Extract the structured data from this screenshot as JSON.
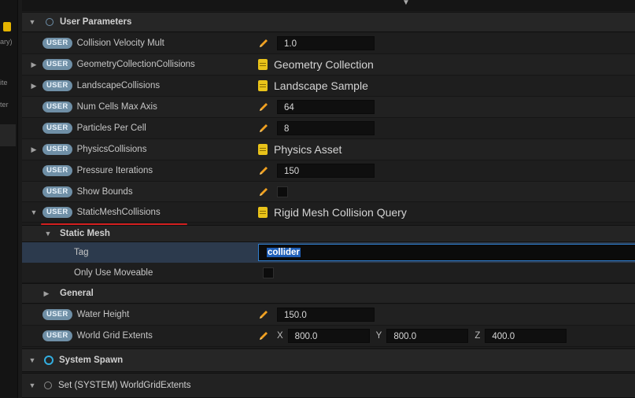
{
  "left_panel": {
    "frag1": "ary)",
    "frag2": "ite",
    "frag3": "ter"
  },
  "section_user": {
    "title": "User Parameters",
    "badge": "USER"
  },
  "params": [
    {
      "name": "Collision Velocity Mult",
      "value": "1.0"
    },
    {
      "name": "GeometryCollectionCollisions",
      "asset": "Geometry Collection"
    },
    {
      "name": "LandscapeCollisions",
      "asset": "Landscape Sample"
    },
    {
      "name": "Num Cells Max Axis",
      "value": "64"
    },
    {
      "name": "Particles Per Cell",
      "value": "8"
    },
    {
      "name": "PhysicsCollisions",
      "asset": "Physics Asset"
    },
    {
      "name": "Pressure Iterations",
      "value": "150"
    },
    {
      "name": "Show Bounds",
      "checked": false
    },
    {
      "name": "StaticMeshCollisions",
      "asset": "Rigid Mesh Collision Query"
    }
  ],
  "static_mesh": {
    "title": "Static Mesh",
    "tag_label": "Tag",
    "tag_value": "collider",
    "only_moveable_label": "Only Use Moveable",
    "only_moveable_checked": false
  },
  "general": {
    "title": "General"
  },
  "water_height": {
    "name": "Water Height",
    "value": "150.0"
  },
  "world_grid": {
    "name": "World Grid Extents",
    "x_label": "X",
    "x_value": "800.0",
    "y_label": "Y",
    "y_value": "800.0",
    "z_label": "Z",
    "z_value": "400.0"
  },
  "section_spawn": {
    "title": "System Spawn"
  },
  "section_set": {
    "title": "Set (SYSTEM) WorldGridExtents"
  },
  "colors": {
    "badge": "#6f8fa6",
    "underline": "#d21e1e",
    "selection": "#1f5fb8",
    "asset_icon": "#e9c31a",
    "spawn_icon": "#32aee0"
  },
  "icons": {
    "edit": "pencil-icon",
    "asset": "asset-icon",
    "expand": "chevron-right-icon",
    "collapse": "chevron-down-icon"
  }
}
